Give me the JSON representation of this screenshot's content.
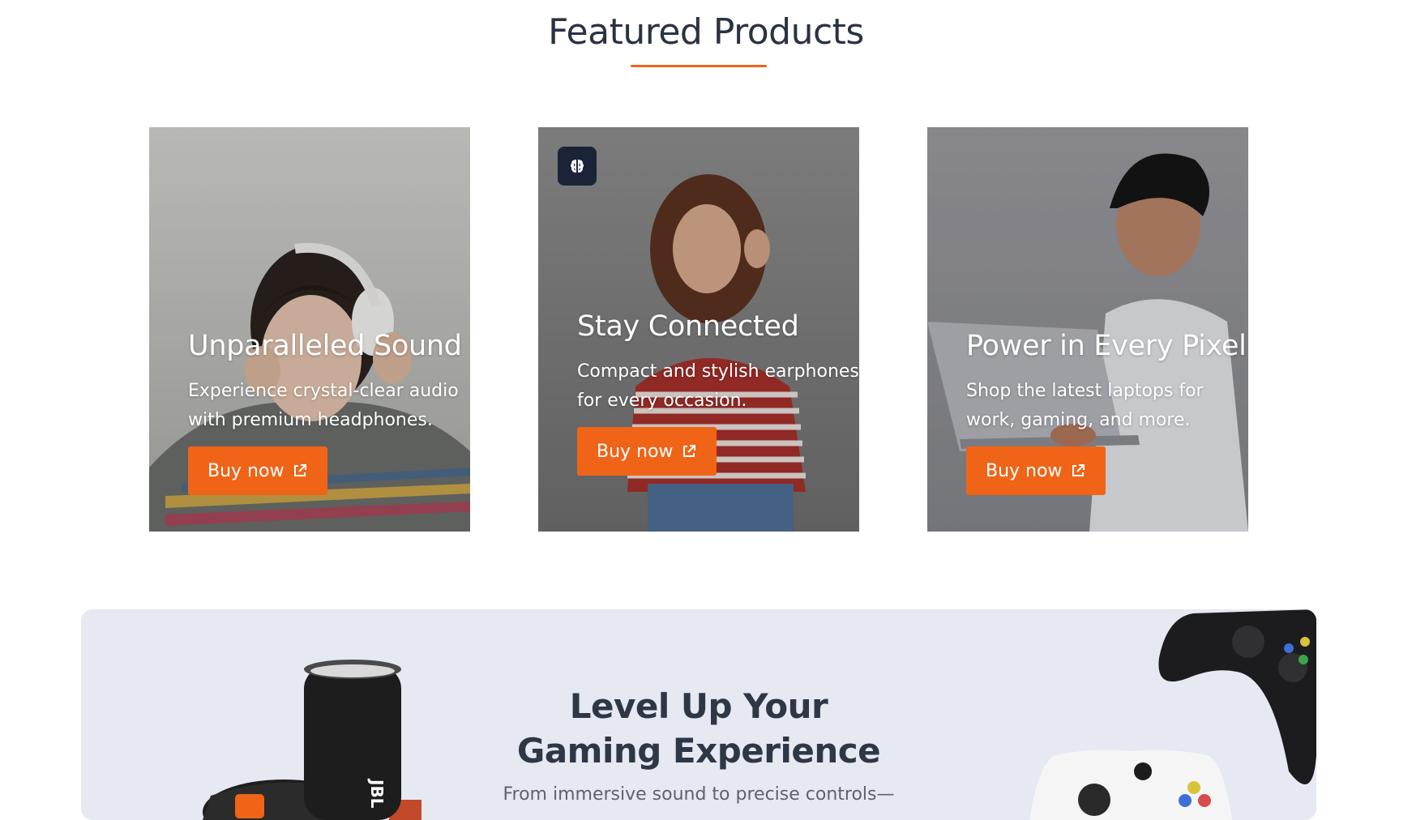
{
  "featured": {
    "title": "Featured Products",
    "cards": [
      {
        "title": "Unparalleled Sound",
        "description": "Experience crystal-clear audio with premium headphones.",
        "button_label": "Buy now",
        "button_icon": "external-link-icon"
      },
      {
        "title": "Stay Connected",
        "description": "Compact and stylish earphones for every occasion.",
        "button_label": "Buy now",
        "button_icon": "external-link-icon",
        "badge_icon": "brain-icon"
      },
      {
        "title": "Power in Every Pixel",
        "description": "Shop the latest laptops for work, gaming, and more.",
        "button_label": "Buy now",
        "button_icon": "external-link-icon"
      }
    ]
  },
  "gaming": {
    "title_line1": "Level Up Your",
    "title_line2": "Gaming Experience",
    "subtitle": "From immersive sound to precise controls—",
    "speaker_brand": "JBL"
  },
  "colors": {
    "accent": "#f06418",
    "heading": "#2a3342",
    "gaming_bg": "#e6e8f2",
    "badge_bg": "#1a2436"
  }
}
